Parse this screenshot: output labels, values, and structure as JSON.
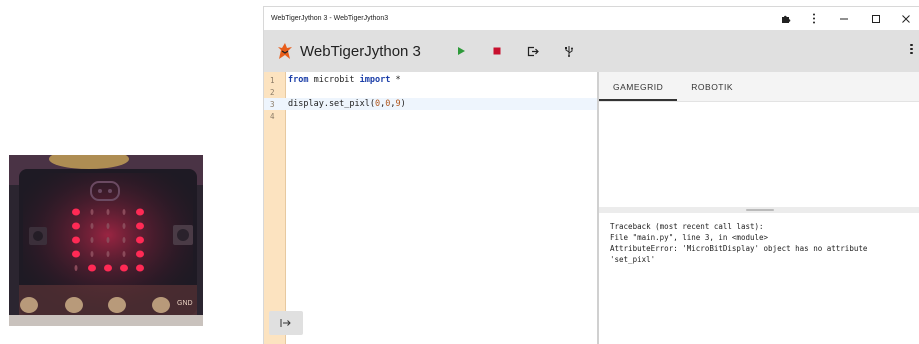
{
  "window": {
    "title": "WebTigerJython 3 - WebTigerJython3"
  },
  "toolbar": {
    "app_name": "WebTigerJython 3",
    "run_label": "run",
    "stop_label": "stop"
  },
  "editor": {
    "lines": [
      {
        "num": "1",
        "tokens": [
          "from",
          " microbit ",
          "import",
          " *"
        ]
      },
      {
        "num": "2"
      },
      {
        "num": "3",
        "prefix": "display.set_pixl(",
        "args": [
          "0",
          "0",
          "9"
        ],
        "suffix": ")"
      },
      {
        "num": "4"
      }
    ],
    "comma": ","
  },
  "tabs": [
    "GAMEGRID",
    "ROBOTIK"
  ],
  "console": {
    "lines": [
      "Traceback (most recent call last):",
      "File \"main.py\", line 3, in <module>",
      "AttributeError: 'MicroBitDisplay' object has no attribute",
      "'set_pixl'"
    ]
  },
  "icons": {
    "run": "play-icon",
    "stop": "stop-icon",
    "export": "export-icon",
    "usb": "usb-icon",
    "extensions": "puzzle-icon",
    "panel_toggle": "arrow-to-right-icon"
  },
  "colors": {
    "run_green": "#2e9a3a",
    "stop_red": "#c8102e",
    "gutter": "#fce3c0",
    "led_red": "#ff2a55"
  },
  "photo": {
    "edge_label": "GND"
  }
}
